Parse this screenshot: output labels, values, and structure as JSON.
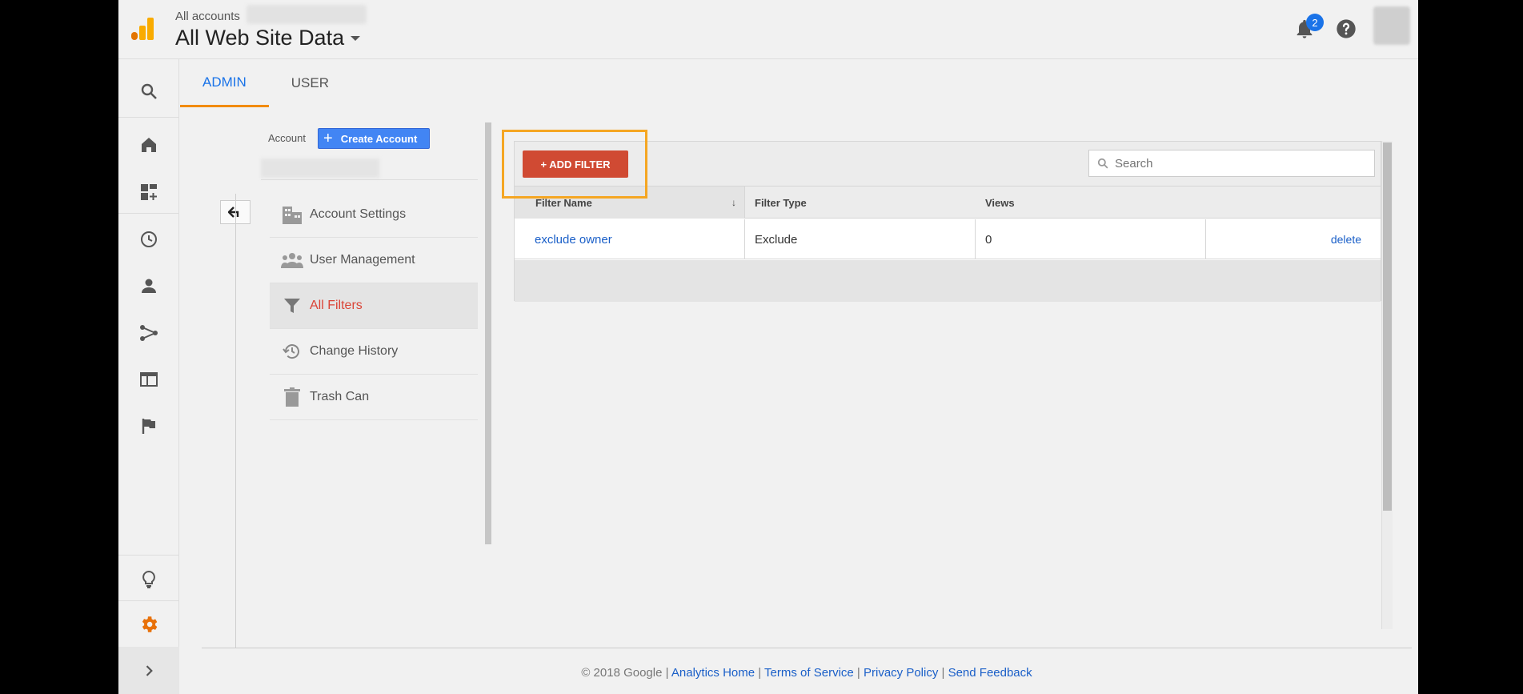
{
  "header": {
    "breadcrumb": "All accounts",
    "property_name": "All Web Site Data",
    "notification_count": "2"
  },
  "tabs": [
    {
      "label": "ADMIN",
      "active": true
    },
    {
      "label": "USER",
      "active": false
    }
  ],
  "account_column": {
    "label": "Account",
    "create_button": "Create Account",
    "menu": [
      {
        "label": "Account Settings",
        "icon": "building-icon"
      },
      {
        "label": "User Management",
        "icon": "people-icon"
      },
      {
        "label": "All Filters",
        "icon": "filter-icon",
        "selected": true
      },
      {
        "label": "Change History",
        "icon": "history-icon"
      },
      {
        "label": "Trash Can",
        "icon": "trash-icon"
      }
    ]
  },
  "filters": {
    "add_button": "+ ADD FILTER",
    "search_placeholder": "Search",
    "columns": [
      "Filter Name",
      "Filter Type",
      "Views"
    ],
    "rows": [
      {
        "name": "exclude owner",
        "type": "Exclude",
        "views": "0",
        "action": "delete"
      }
    ]
  },
  "footer": {
    "copyright": "© 2018 Google",
    "links": [
      "Analytics Home",
      "Terms of Service",
      "Privacy Policy",
      "Send Feedback"
    ]
  },
  "colors": {
    "accent_blue": "#1a73e8",
    "add_filter_red": "#d04a33",
    "tab_underline_orange": "#f28b00",
    "highlight_orange": "#f5a623",
    "logo_orange": "#f9ab00"
  }
}
